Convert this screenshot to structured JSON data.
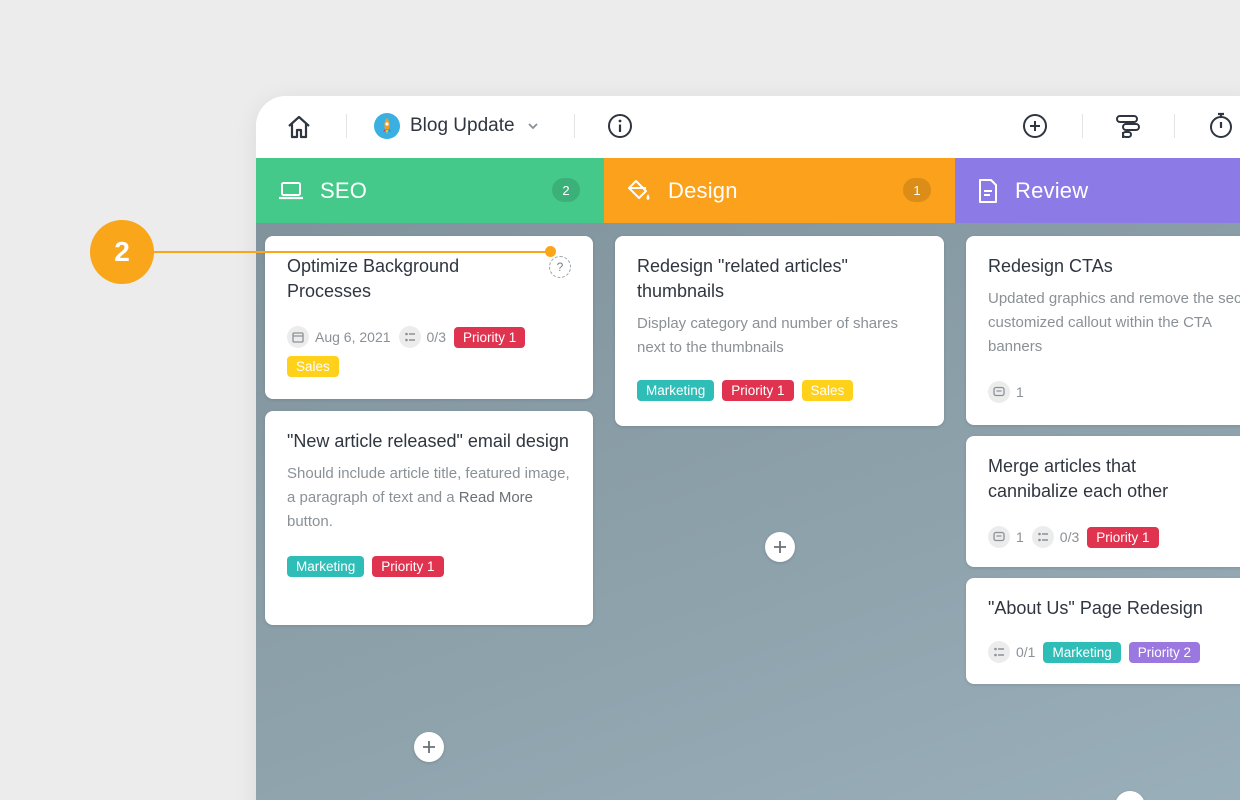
{
  "callout": {
    "number": "2"
  },
  "topbar": {
    "project_name": "Blog Update"
  },
  "columns": [
    {
      "title": "SEO",
      "count": "2",
      "color": "#45c98a",
      "cards": [
        {
          "title": "Optimize Background Processes",
          "date": "Aug 6, 2021",
          "checklist": "0/3",
          "tags": [
            "Priority 1",
            "Sales"
          ]
        },
        {
          "title": "\"New article released\" email design",
          "desc_pre": "Should include article title, featured image, a paragraph of text and a ",
          "desc_bold": "Read More",
          "desc_post": " button.",
          "tags": [
            "Marketing",
            "Priority 1"
          ]
        }
      ]
    },
    {
      "title": "Design",
      "count": "1",
      "color": "#fba11b",
      "cards": [
        {
          "title": "Redesign \"related articles\" thumbnails",
          "desc": "Display category and number of shares next to the thumbnails",
          "tags": [
            "Marketing",
            "Priority 1",
            "Sales"
          ]
        }
      ]
    },
    {
      "title": "Review",
      "count": "",
      "color": "#8c7be6",
      "cards": [
        {
          "title": "Redesign CTAs",
          "desc": "Updated graphics and remove the second customized callout within the CTA banners",
          "comments": "1"
        },
        {
          "title": "Merge articles that cannibalize each other",
          "comments": "1",
          "checklist": "0/3",
          "tags": [
            "Priority 1"
          ]
        },
        {
          "title": "\"About Us\" Page Redesign",
          "checklist": "0/1",
          "tags": [
            "Marketing",
            "Priority 2"
          ]
        }
      ]
    }
  ]
}
